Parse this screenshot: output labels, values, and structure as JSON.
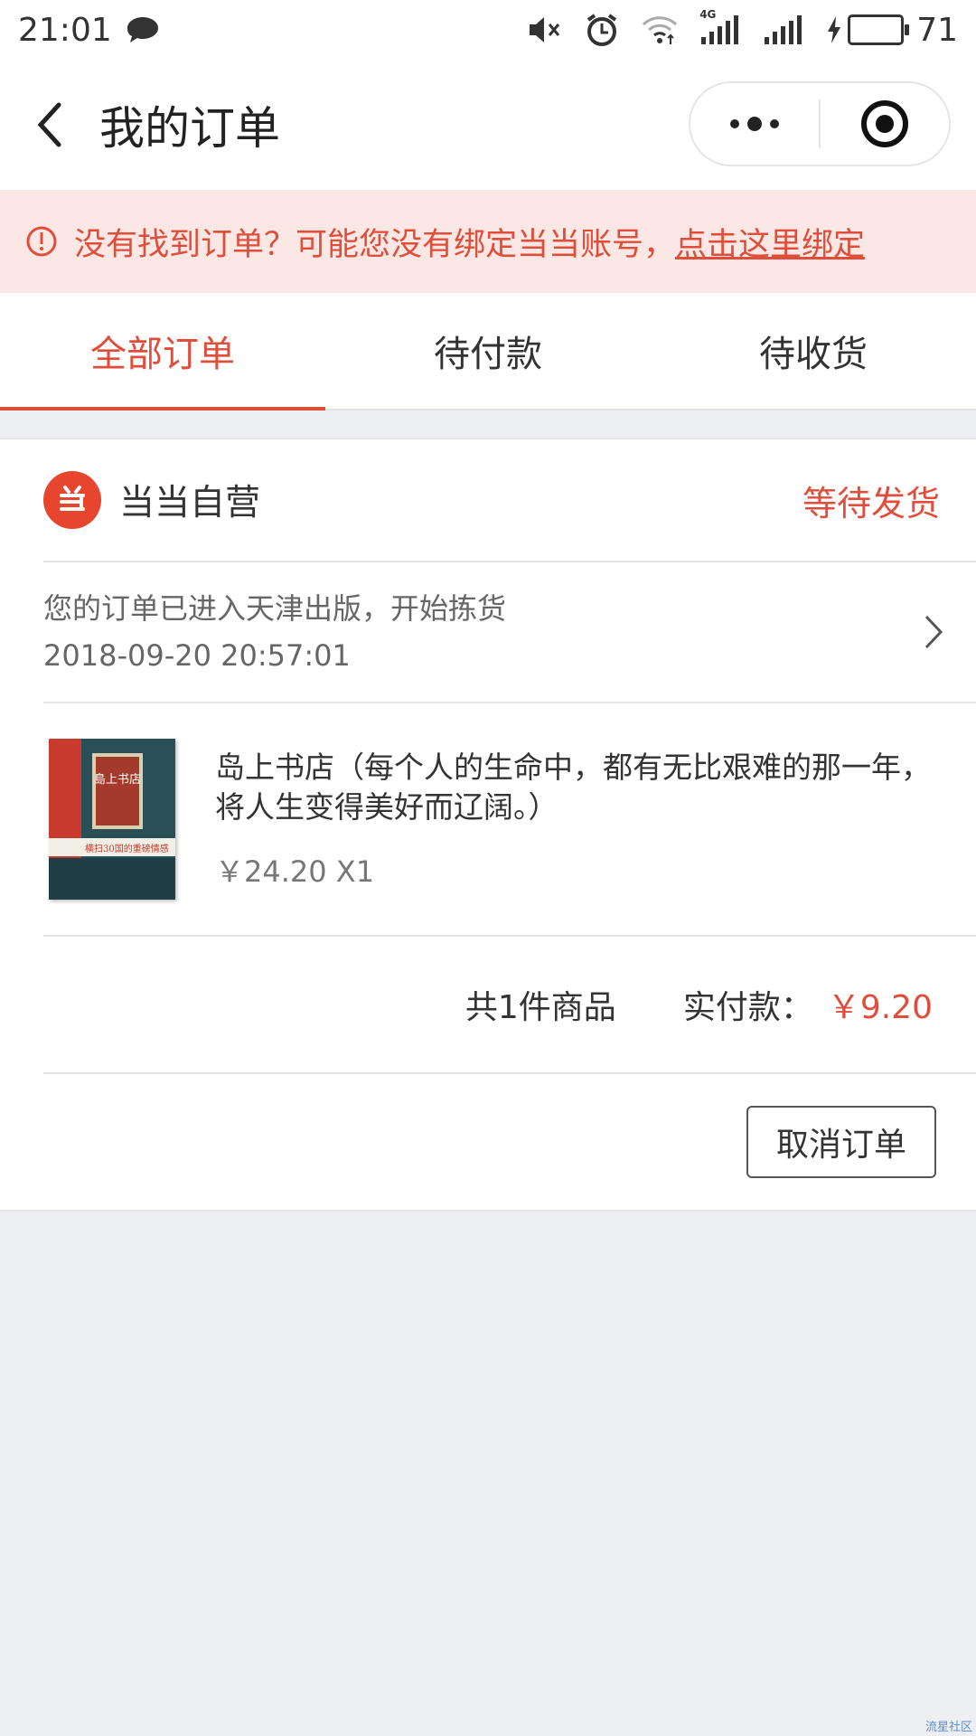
{
  "status_bar": {
    "time": "21:01",
    "network": "4G",
    "battery": "71",
    "battery_color": "#3dc53d"
  },
  "navbar": {
    "title": "我的订单",
    "icons": [
      "back-arrow-icon",
      "more-icon",
      "record-icon"
    ]
  },
  "notice": {
    "text": "没有找到订单？可能您没有绑定当当账号，",
    "link": "点击这里绑定"
  },
  "tabs": [
    {
      "label": "全部订单",
      "active": true
    },
    {
      "label": "待付款",
      "active": false
    },
    {
      "label": "待收货",
      "active": false
    }
  ],
  "order": {
    "shop_name": "当当自营",
    "status": "等待发货",
    "logistics_message": "您的订单已进入天津出版，开始拣货",
    "logistics_time": "2018-09-20 20:57:01",
    "product": {
      "cover_title": "島上书店",
      "cover_band": "横扫30国的重磅情感大书",
      "name": "岛上书店（每个人的生命中，都有无比艰难的那一年，将人生变得美好而辽阔。）",
      "price": "￥24.20 X1"
    },
    "item_count": "共1件商品",
    "paid_label": "实付款：",
    "paid_amount": "￥9.20",
    "cancel_label": "取消订单"
  },
  "watermark": "流星社区",
  "colors": {
    "accent": "#e04e3b",
    "notice_bg": "#fbe8e5",
    "page_bg": "#eeeff3"
  }
}
